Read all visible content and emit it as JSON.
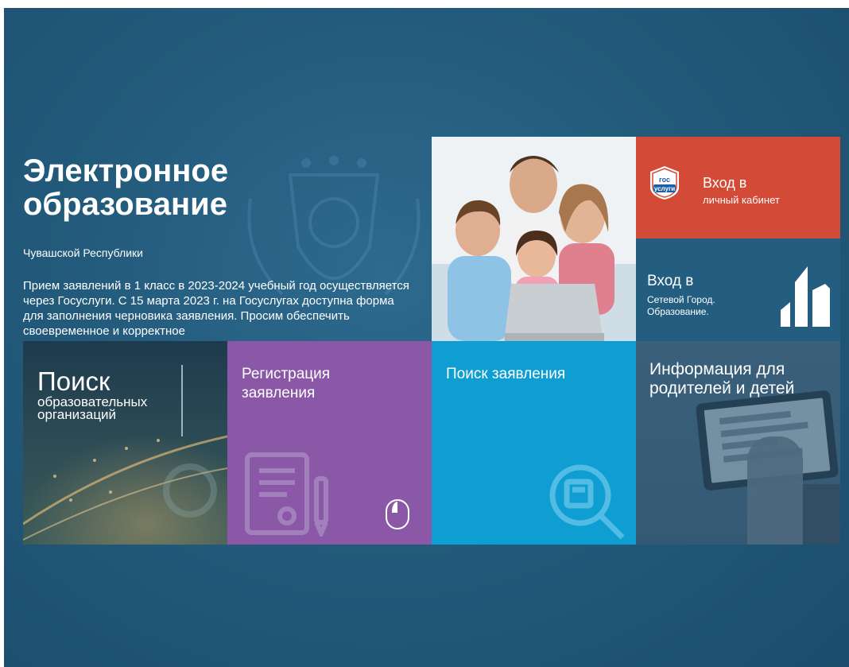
{
  "hero": {
    "title": "Электронное образование",
    "subtitle": "Чувашской Республики",
    "notice": "Прием заявлений в 1 класс в 2023-2024 учебный год осуществляется через Госуслуги. С 15 марта 2023 г. на Госуслугах доступна форма для заполнения черновика заявления. Просим обеспечить своевременное и корректное"
  },
  "tiles": {
    "gosuslugi": {
      "title": "Вход в",
      "subtitle": "личный кабинет",
      "logo_top": "гос",
      "logo_bottom": "услуги",
      "color": "#d34a36"
    },
    "setevoy_gorod": {
      "title": "Вход в",
      "subtitle": "Сетевой Город. Образование.",
      "color": "#235d80"
    },
    "search_orgs": {
      "title": "Поиск",
      "subtitle": "образовательных организаций"
    },
    "registration": {
      "title": "Регистрация заявления",
      "color": "#8a58a7"
    },
    "search_application": {
      "title": "Поиск заявления",
      "color": "#0f9ed2"
    },
    "info": {
      "title": "Информация для родителей и детей"
    }
  },
  "icons": {
    "gosuslugi_logo": "gosuslugi-logo-icon",
    "setevoy_gorod_logo": "setevoy-gorod-logo-icon",
    "registration": "document-pen-icon",
    "mouse": "mouse-icon",
    "search": "magnifier-document-icon"
  },
  "colors": {
    "background": "#235b7c",
    "white": "#ffffff"
  }
}
